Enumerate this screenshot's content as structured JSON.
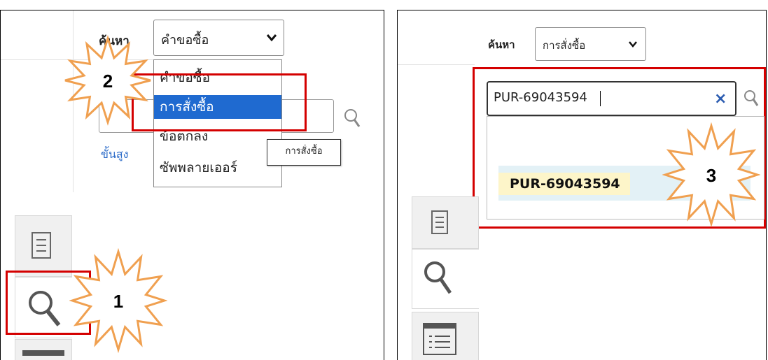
{
  "left": {
    "search_label": "ค้นหา",
    "select_value": "คำขอซื้อ",
    "advanced_link": "ขั้นสูง",
    "dropdown_options": [
      {
        "label": "คำขอซื้อ",
        "selected": false
      },
      {
        "label": "การสั่งซื้อ",
        "selected": true
      },
      {
        "label": "ข้อตกลง",
        "selected": false
      },
      {
        "label": "ซัพพลายเออร์",
        "selected": false
      }
    ],
    "tooltip": "การสั่งซื้อ",
    "step_1": "1",
    "step_2": "2"
  },
  "right": {
    "search_label": "ค้นหา",
    "select_value": "การสั่งซื้อ",
    "search_value": "PUR-69043594",
    "suggestion": "PUR-69043594",
    "step_3": "3"
  },
  "colors": {
    "highlight_box": "#d40000",
    "starburst": "#f0a050",
    "selected_option": "#1f6ad0",
    "link": "#2a6ac8",
    "clear_icon": "#2a5bb0"
  },
  "icons": [
    "search-icon",
    "chevron-down-icon",
    "document-icon",
    "list-icon",
    "clear-icon",
    "starburst-callout"
  ]
}
